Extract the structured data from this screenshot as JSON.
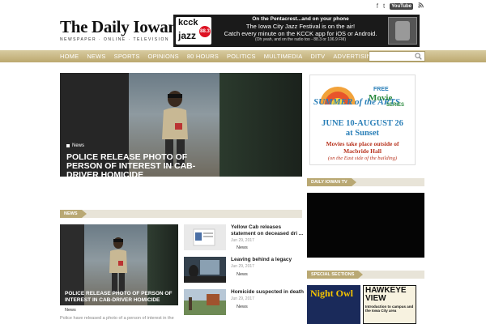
{
  "social": {
    "facebook": "f",
    "twitter": "t",
    "youtube": "YouTube",
    "rss": "rss"
  },
  "masthead": {
    "title": "The Daily Iowan",
    "tagline": "NEWSPAPER · ONLINE · TELEVISION"
  },
  "banner": {
    "logo_top": "kcck",
    "logo_bottom": "jazz",
    "logo_freq": "88.3",
    "line1": "On the Pentacrest...and on your phone",
    "line2": "The Iowa City Jazz Festival is on the air!",
    "line3": "Catch every minute on the KCCK app for iOS or Android.",
    "line4": "(Oh yeah, and on the radio too - 88.3 or 106.9 FM)"
  },
  "nav": [
    "HOME",
    "NEWS",
    "SPORTS",
    "OPINIONS",
    "80 HOURS",
    "POLITICS",
    "MULTIMEDIA",
    "DITV",
    "ADVERTISING"
  ],
  "search": {
    "placeholder": ""
  },
  "hero": {
    "tag": "News",
    "title": "POLICE RELEASE PHOTO OF PERSON OF INTEREST IN CAB-DRIVER HOMICIDE"
  },
  "ad": {
    "summer": "SUMMER of the ARTS",
    "free": "FREE",
    "movie": "Movie",
    "series": "SERIES",
    "dates": "JUNE 10-AUGUST 26",
    "sunset": "at Sunset",
    "sub1": "Movies take place outside of",
    "sub2": "Macbride Hall",
    "sub3": "(on the East side of the building)"
  },
  "sections": {
    "news": "News",
    "tv": "DAILY IOWAN TV",
    "special": "SPECIAL SECTIONS"
  },
  "featured": {
    "title": "POLICE RELEASE PHOTO OF PERSON OF INTEREST IN CAB-DRIVER HOMICIDE",
    "tag": "News",
    "excerpt": "Police have released a photo of a person of interest in the"
  },
  "stories": [
    {
      "title": "Yellow Cab releases statement on deceased dri ...",
      "date": "Jun 29, 2017",
      "tag": "News"
    },
    {
      "title": "Leaving behind a legacy",
      "date": "Jun 29, 2017",
      "tag": "News"
    },
    {
      "title": "Homicide suspected in death",
      "date": "Jun 29, 2017",
      "tag": "News"
    }
  ],
  "special": {
    "night": "Night Owl",
    "hawk_title": "HAWKEYE VIEW",
    "hawk_sub": "Introduction to campus and the Iowa City area"
  }
}
